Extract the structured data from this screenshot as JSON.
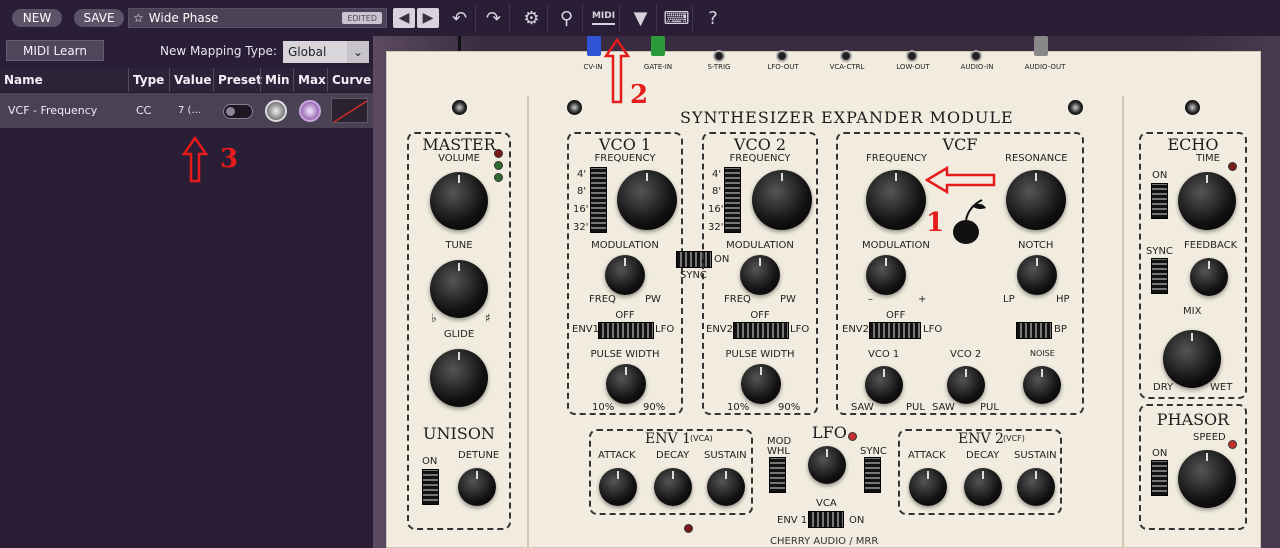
{
  "toolbar": {
    "new_label": "NEW",
    "save_label": "SAVE",
    "preset_name": "Wide Phase",
    "edited_badge": "EDITED",
    "midi_label": "MIDI"
  },
  "midi_panel": {
    "midi_learn_label": "MIDI Learn",
    "mapping_type_label": "New Mapping Type:",
    "mapping_type_value": "Global",
    "columns": [
      "Name",
      "Type",
      "Value",
      "Preset",
      "Min",
      "Max",
      "Curve"
    ],
    "rows": [
      {
        "name": "VCF - Frequency",
        "type": "CC",
        "value": "7 (..."
      }
    ]
  },
  "synth": {
    "title": "SYNTHESIZER EXPANDER MODULE",
    "jacks": [
      "CV-IN",
      "GATE-IN",
      "S-TRIG",
      "LFO-OUT",
      "VCA-CTRL",
      "LOW-OUT",
      "AUDIO-IN",
      "AUDIO-OUT"
    ],
    "master": {
      "title": "MASTER",
      "volume": "VOLUME",
      "tune": "TUNE",
      "glide": "GLIDE",
      "unison": "UNISON",
      "on": "ON",
      "detune": "DETUNE"
    },
    "vco1": {
      "title": "VCO 1",
      "frequency": "FREQUENCY",
      "octaves": [
        "4'",
        "8'",
        "16'",
        "32'"
      ],
      "modulation": "MODULATION",
      "freq": "FREQ",
      "pw": "PW",
      "off": "OFF",
      "env": "ENV1",
      "lfo": "LFO",
      "pulse_width": "PULSE WIDTH",
      "pw_min": "10%",
      "pw_max": "90%"
    },
    "vco2": {
      "title": "VCO 2",
      "frequency": "FREQUENCY",
      "octaves": [
        "4'",
        "8'",
        "16'",
        "32'"
      ],
      "modulation": "MODULATION",
      "freq": "FREQ",
      "pw": "PW",
      "off": "OFF",
      "env": "ENV2",
      "lfo": "LFO",
      "pulse_width": "PULSE WIDTH",
      "pw_min": "10%",
      "pw_max": "90%"
    },
    "sync": {
      "on": "ON",
      "label": "SYNC"
    },
    "vcf": {
      "title": "VCF",
      "frequency": "FREQUENCY",
      "resonance": "RESONANCE",
      "modulation": "MODULATION",
      "minus": "–",
      "plus": "+",
      "notch": "NOTCH",
      "lp": "LP",
      "hp": "HP",
      "off": "OFF",
      "env": "ENV2",
      "lfo": "LFO",
      "bp": "BP",
      "vco1": "VCO 1",
      "vco2": "VCO 2",
      "noise": "NOISE",
      "saw": "SAW",
      "pul": "PUL"
    },
    "echo": {
      "title": "ECHO",
      "time": "TIME",
      "on": "ON",
      "sync": "SYNC",
      "feedback": "FEEDBACK",
      "mix": "MIX",
      "dry": "DRY",
      "wet": "WET"
    },
    "phasor": {
      "title": "PHASOR",
      "speed": "SPEED",
      "on": "ON"
    },
    "env1": {
      "title": "ENV 1",
      "sub": "(VCA)",
      "attack": "ATTACK",
      "decay": "DECAY",
      "sustain": "SUSTAIN"
    },
    "env2": {
      "title": "ENV 2",
      "sub": "(VCF)",
      "attack": "ATTACK",
      "decay": "DECAY",
      "sustain": "SUSTAIN"
    },
    "lfo": {
      "title": "LFO",
      "mod_whl_1": "MOD",
      "mod_whl_2": "WHL",
      "sync": "SYNC",
      "vca": "VCA",
      "env1": "ENV 1",
      "on": "ON"
    },
    "footer": "CHERRY AUDIO / MRR"
  },
  "annotations": {
    "one": "1",
    "two": "2",
    "three": "3"
  }
}
